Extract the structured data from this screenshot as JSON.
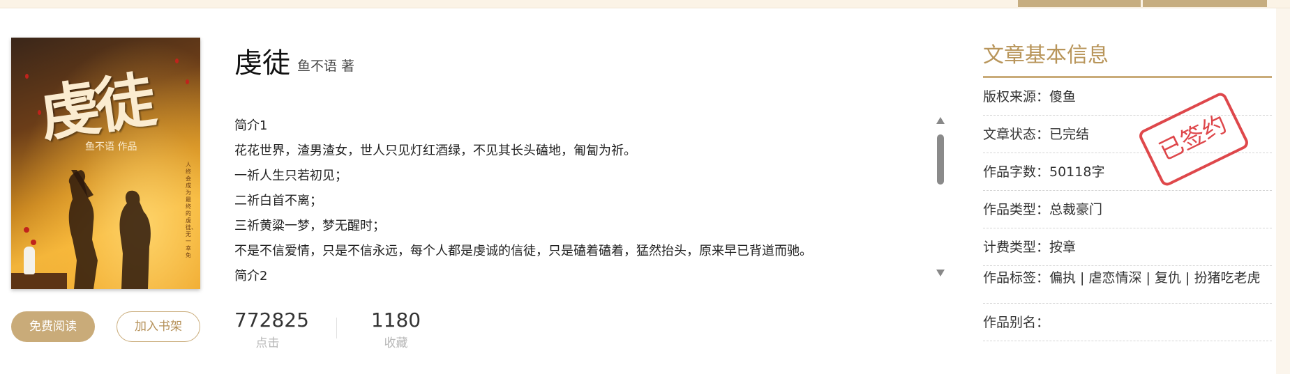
{
  "book": {
    "title": "虔徒",
    "author": "鱼不语 著",
    "cover": {
      "title": "虔徒",
      "author": "鱼不语 作品",
      "tagline": "人终会成为最终的虔徒、无一幸免"
    }
  },
  "actions": {
    "read_free": "免费阅读",
    "add_shelf": "加入书架"
  },
  "description": [
    "简介1",
    "花花世界，渣男渣女，世人只见灯红酒绿，不见其长头磕地，匍匐为祈。",
    "一祈人生只若初见；",
    "二祈白首不离；",
    "三祈黄粱一梦，梦无醒时；",
    "不是不信爱情，只是不信永远，每个人都是虔诚的信徒，只是磕着磕着，猛然抬头，原来早已背道而驰。",
    "简介2"
  ],
  "stats": {
    "clicks": "772825",
    "clicks_label": "点击",
    "favorites": "1180",
    "favorites_label": "收藏"
  },
  "info": {
    "title": "文章基本信息",
    "stamp": "已签约",
    "rows": [
      "版权来源：傻鱼",
      "文章状态：已完结",
      "作品字数：50118字",
      "作品类型：总裁豪门",
      "计费类型：按章",
      "作品标签：偏执 | 虐恋情深 | 复仇 | 扮猪吃老虎",
      "作品别名："
    ]
  },
  "colors": {
    "accent": "#c9ab79",
    "accent_text": "#b8955a",
    "stamp": "#d9282c"
  }
}
